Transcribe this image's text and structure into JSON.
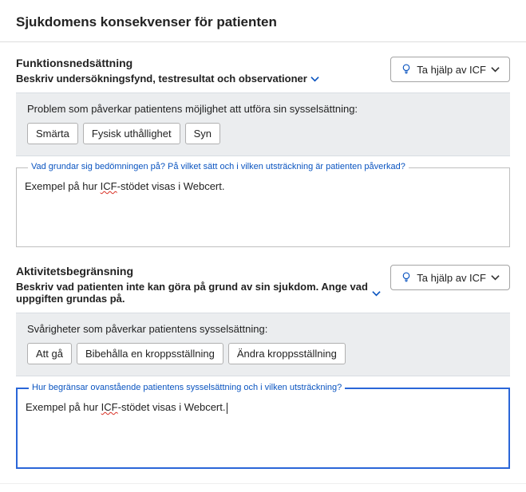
{
  "header": {
    "title": "Sjukdomens konsekvenser för patienten"
  },
  "icf_button_label": "Ta hjälp av ICF",
  "section1": {
    "title": "Funktionsnedsättning",
    "subtitle": "Beskriv undersökningsfynd, testresultat och observationer",
    "box_label": "Problem som påverkar patientens möjlighet att utföra sin sysselsättning:",
    "tags": [
      "Smärta",
      "Fysisk uthållighet",
      "Syn"
    ],
    "field_legend": "Vad grundar sig bedömningen på? På vilket sätt och i vilken utsträckning är patienten påverkad?",
    "field_value_pre": "Exempel på hur ",
    "field_value_wavy": "ICF",
    "field_value_post": "-stödet visas i Webcert."
  },
  "section2": {
    "title": "Aktivitetsbegränsning",
    "subtitle": "Beskriv vad patienten inte kan göra på grund av sin sjukdom. Ange vad uppgiften grundas på.",
    "box_label": "Svårigheter som påverkar patientens sysselsättning:",
    "tags": [
      "Att gå",
      "Bibehålla en kroppsställning",
      "Ändra kroppsställning"
    ],
    "field_legend": "Hur begränsar ovanstående patientens sysselsättning och i vilken utsträckning?",
    "field_value_pre": "Exempel på hur ",
    "field_value_wavy": "ICF",
    "field_value_post": "-stödet visas i Webcert."
  }
}
